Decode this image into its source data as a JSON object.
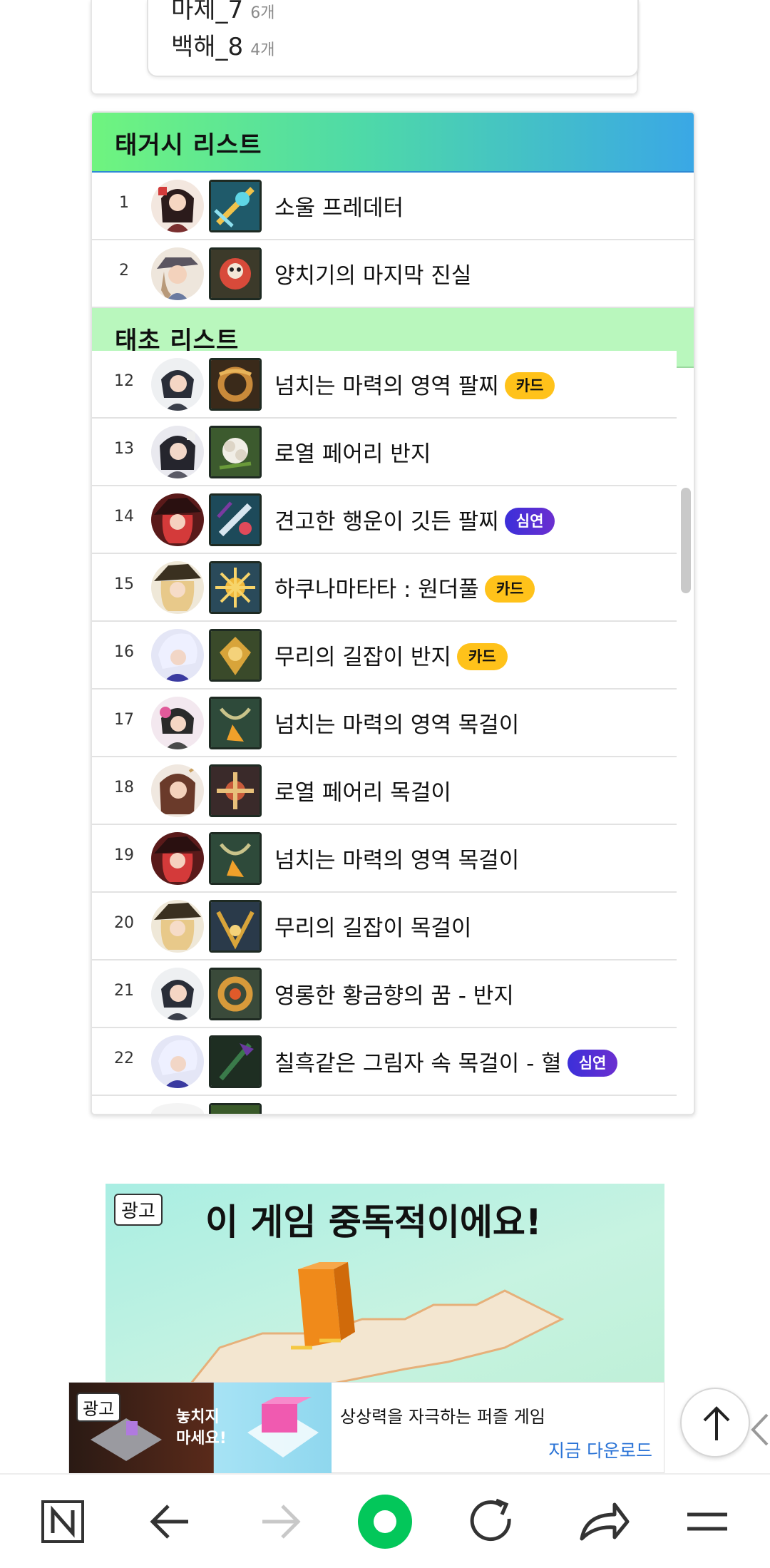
{
  "counts": [
    {
      "label": "마제_7",
      "count": "6개"
    },
    {
      "label": "백해_8",
      "count": "4개"
    }
  ],
  "tg_list": {
    "title": "태거시 리스트",
    "rows": [
      {
        "rank": "1",
        "name": "소울 프레데터",
        "badge": ""
      },
      {
        "rank": "2",
        "name": "양치기의 마지막 진실",
        "badge": ""
      }
    ]
  },
  "tc_list": {
    "title": "태초 리스트",
    "rows": [
      {
        "rank": "12",
        "name": "넘치는 마력의 영역 팔찌",
        "badge": "카드",
        "badge_type": "card"
      },
      {
        "rank": "13",
        "name": "로열 페어리 반지",
        "badge": ""
      },
      {
        "rank": "14",
        "name": "견고한 행운이 깃든 팔찌",
        "badge": "심연",
        "badge_type": "deep"
      },
      {
        "rank": "15",
        "name": "하쿠나마타타 : 원더풀",
        "badge": "카드",
        "badge_type": "card"
      },
      {
        "rank": "16",
        "name": "무리의 길잡이 반지",
        "badge": "카드",
        "badge_type": "card"
      },
      {
        "rank": "17",
        "name": "넘치는 마력의 영역 목걸이",
        "badge": ""
      },
      {
        "rank": "18",
        "name": "로열 페어리 목걸이",
        "badge": ""
      },
      {
        "rank": "19",
        "name": "넘치는 마력의 영역 목걸이",
        "badge": ""
      },
      {
        "rank": "20",
        "name": "무리의 길잡이 목걸이",
        "badge": ""
      },
      {
        "rank": "21",
        "name": "영롱한 황금향의 꿈 - 반지",
        "badge": ""
      },
      {
        "rank": "22",
        "name": "칠흑같은 그림자 속 목걸이 - 혈",
        "badge": "심연",
        "badge_type": "deep"
      }
    ]
  },
  "ad": {
    "tag": "광고",
    "headline": "이 게임 중독적이에요!"
  },
  "banner": {
    "tag": "광고",
    "image_text_1": "놓치지",
    "image_text_2": "마세요!",
    "text": "상상력을 자극하는 퍼즐 게임",
    "cta": "지금 다운로드"
  },
  "colors": {
    "badge_card": "#ffc21a",
    "badge_deep": "#4a2fd8",
    "tg_header_start": "#6ff47f",
    "tg_header_end": "#3aa7e6",
    "tc_header": "#b9f7bd",
    "nav_accent": "#03c75a",
    "link": "#2a73d6"
  },
  "nav": {
    "items": [
      "naver-home-icon",
      "back-arrow-icon",
      "forward-arrow-icon",
      "green-dot-icon",
      "refresh-icon",
      "share-icon",
      "menu-icon"
    ]
  }
}
